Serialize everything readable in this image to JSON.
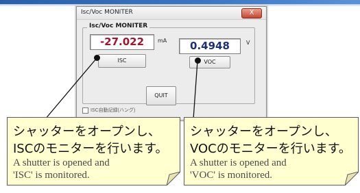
{
  "window": {
    "title": "Isc/Voc MONITER",
    "close_label": "X",
    "group_label": "Isc/Voc MONITER"
  },
  "isc": {
    "value": "-27.022",
    "unit": "mA",
    "button_label": "ISC"
  },
  "voc": {
    "value": "0.4948",
    "unit": "V",
    "button_label": "VOC"
  },
  "quit_label": "QUIT",
  "checkbox_label": "ISC自動記録(ハング)",
  "callouts": {
    "left": {
      "jp_line1": "シャッターをオープンし、",
      "jp_line2": "ISCのモニターを行います。",
      "en_line1": "A shutter is opened and",
      "en_line2": "'ISC' is monitored."
    },
    "right": {
      "jp_line1": "シャッターをオープンし、",
      "jp_line2": "VOCのモニターを行います。",
      "en_line1": "A shutter is opened and",
      "en_line2": "'VOC' is monitored."
    }
  },
  "colors": {
    "isc_value": "#a0142c",
    "voc_value": "#1d2f7a",
    "callout_bg": "#ffffcf"
  }
}
